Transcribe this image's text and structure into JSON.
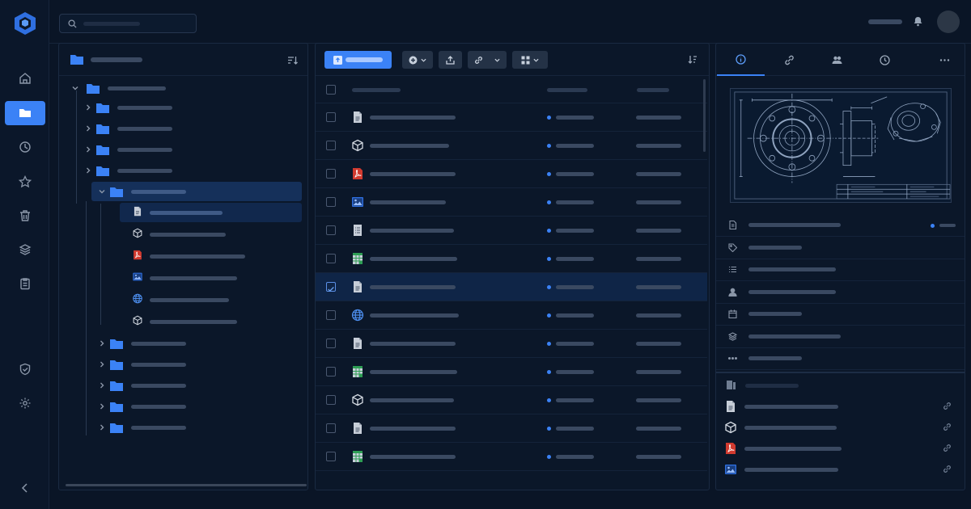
{
  "app": {
    "brand_color": "#3b82f6",
    "background": "#0a1526"
  },
  "rail": {
    "items": [
      {
        "icon": "home-icon"
      },
      {
        "icon": "folder-icon",
        "active": true
      },
      {
        "icon": "clock-icon"
      },
      {
        "icon": "star-icon"
      },
      {
        "icon": "trash-icon"
      },
      {
        "icon": "layers-icon"
      },
      {
        "icon": "clipboard-icon"
      }
    ],
    "bottom": [
      {
        "icon": "shield-check-icon"
      },
      {
        "icon": "gear-icon"
      },
      {
        "icon": "chevron-left-icon"
      }
    ]
  },
  "topbar": {
    "search_placeholder": "",
    "icons": [
      "search-icon",
      "bell-icon",
      "avatar"
    ]
  },
  "tree": {
    "header_icon": "folder-icon",
    "sort_icon": "sort-icon",
    "nodes": [
      {
        "type": "folder",
        "expanded": true,
        "level": 0
      },
      {
        "type": "folder",
        "expanded": false,
        "level": 1
      },
      {
        "type": "folder",
        "expanded": false,
        "level": 1
      },
      {
        "type": "folder",
        "expanded": false,
        "level": 1
      },
      {
        "type": "folder",
        "expanded": false,
        "level": 1
      },
      {
        "type": "folder",
        "expanded": true,
        "level": 1,
        "selected": true
      },
      {
        "type": "document",
        "level": 2,
        "selected": true
      },
      {
        "type": "cube",
        "level": 2
      },
      {
        "type": "pdf",
        "level": 2
      },
      {
        "type": "image",
        "level": 2
      },
      {
        "type": "globe",
        "level": 2
      },
      {
        "type": "cube",
        "level": 2
      },
      {
        "type": "folder",
        "expanded": false,
        "level": 1
      },
      {
        "type": "folder",
        "expanded": false,
        "level": 1
      },
      {
        "type": "folder",
        "expanded": false,
        "level": 1
      },
      {
        "type": "folder",
        "expanded": false,
        "level": 1
      },
      {
        "type": "folder",
        "expanded": false,
        "level": 1
      }
    ]
  },
  "toolbar": {
    "buttons": [
      {
        "icon": "upload-icon",
        "primary": true
      },
      {
        "icon": "plus-circle-icon",
        "dropdown": true
      },
      {
        "icon": "share-icon"
      },
      {
        "icon": "link-icon",
        "dropdown": true
      },
      {
        "icon": "grid-icon",
        "dropdown": true
      }
    ],
    "sort_icon": "sort-icon"
  },
  "files": {
    "rows": [
      {
        "type": "document",
        "checked": false
      },
      {
        "type": "cube",
        "checked": false
      },
      {
        "type": "pdf",
        "checked": false
      },
      {
        "type": "image",
        "checked": false
      },
      {
        "type": "list",
        "checked": false
      },
      {
        "type": "sheet",
        "checked": false
      },
      {
        "type": "document",
        "checked": true
      },
      {
        "type": "globe",
        "checked": false
      },
      {
        "type": "document",
        "checked": false
      },
      {
        "type": "sheet",
        "checked": false
      },
      {
        "type": "cube",
        "checked": false
      },
      {
        "type": "document",
        "checked": false
      },
      {
        "type": "sheet",
        "checked": false
      }
    ]
  },
  "details": {
    "tabs": [
      {
        "icon": "info-icon",
        "active": true
      },
      {
        "icon": "link-icon"
      },
      {
        "icon": "users-icon"
      },
      {
        "icon": "clock-icon"
      },
      {
        "icon": "more-icon"
      }
    ],
    "preview": "technical-drawing",
    "properties": [
      {
        "icon": "document-icon"
      },
      {
        "icon": "tag-icon"
      },
      {
        "icon": "list-icon"
      },
      {
        "icon": "user-icon"
      },
      {
        "icon": "calendar-icon"
      },
      {
        "icon": "layers-icon"
      },
      {
        "icon": "more-icon"
      }
    ],
    "related_header_icon": "files-icon",
    "related": [
      {
        "type": "document"
      },
      {
        "type": "cube"
      },
      {
        "type": "pdf"
      },
      {
        "type": "image"
      }
    ]
  }
}
